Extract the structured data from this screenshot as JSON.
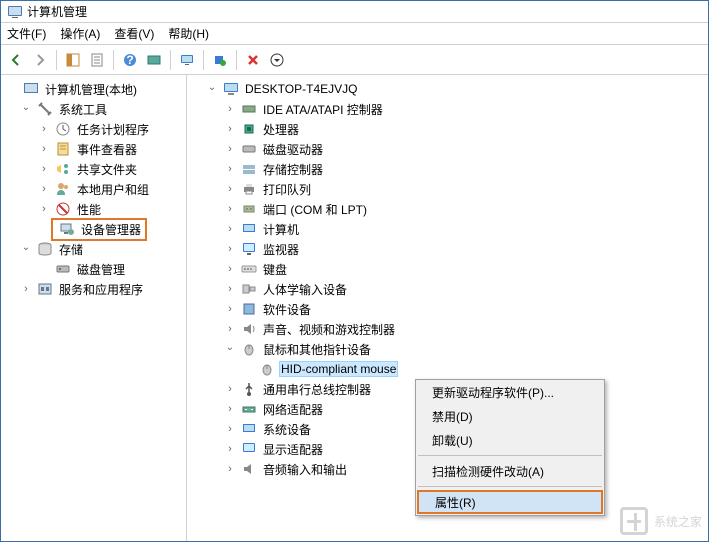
{
  "window": {
    "title": "计算机管理"
  },
  "menu": {
    "file": "文件(F)",
    "action": "操作(A)",
    "view": "查看(V)",
    "help": "帮助(H)"
  },
  "left_tree": {
    "root": "计算机管理(本地)",
    "system_tools": "系统工具",
    "task_scheduler": "任务计划程序",
    "event_viewer": "事件查看器",
    "shared_folders": "共享文件夹",
    "local_users": "本地用户和组",
    "performance": "性能",
    "device_manager": "设备管理器",
    "storage": "存储",
    "disk_mgmt": "磁盘管理",
    "services_apps": "服务和应用程序"
  },
  "right_tree": {
    "computer": "DESKTOP-T4EJVJQ",
    "ide": "IDE ATA/ATAPI 控制器",
    "cpu": "处理器",
    "disk_drives": "磁盘驱动器",
    "storage_ctrl": "存储控制器",
    "print_queues": "打印队列",
    "ports": "端口 (COM 和 LPT)",
    "computers": "计算机",
    "monitors": "监视器",
    "keyboards": "键盘",
    "hid": "人体学输入设备",
    "software_dev": "软件设备",
    "sound": "声音、视频和游戏控制器",
    "mouse_cat": "鼠标和其他指针设备",
    "hid_mouse": "HID-compliant mouse",
    "usb": "通用串行总线控制器",
    "network": "网络适配器",
    "system_dev": "系统设备",
    "display": "显示适配器",
    "audio_io": "音频输入和输出"
  },
  "context_menu": {
    "update_driver": "更新驱动程序软件(P)...",
    "disable": "禁用(D)",
    "uninstall": "卸载(U)",
    "scan": "扫描检测硬件改动(A)",
    "properties": "属性(R)"
  },
  "watermark": "系统之家"
}
